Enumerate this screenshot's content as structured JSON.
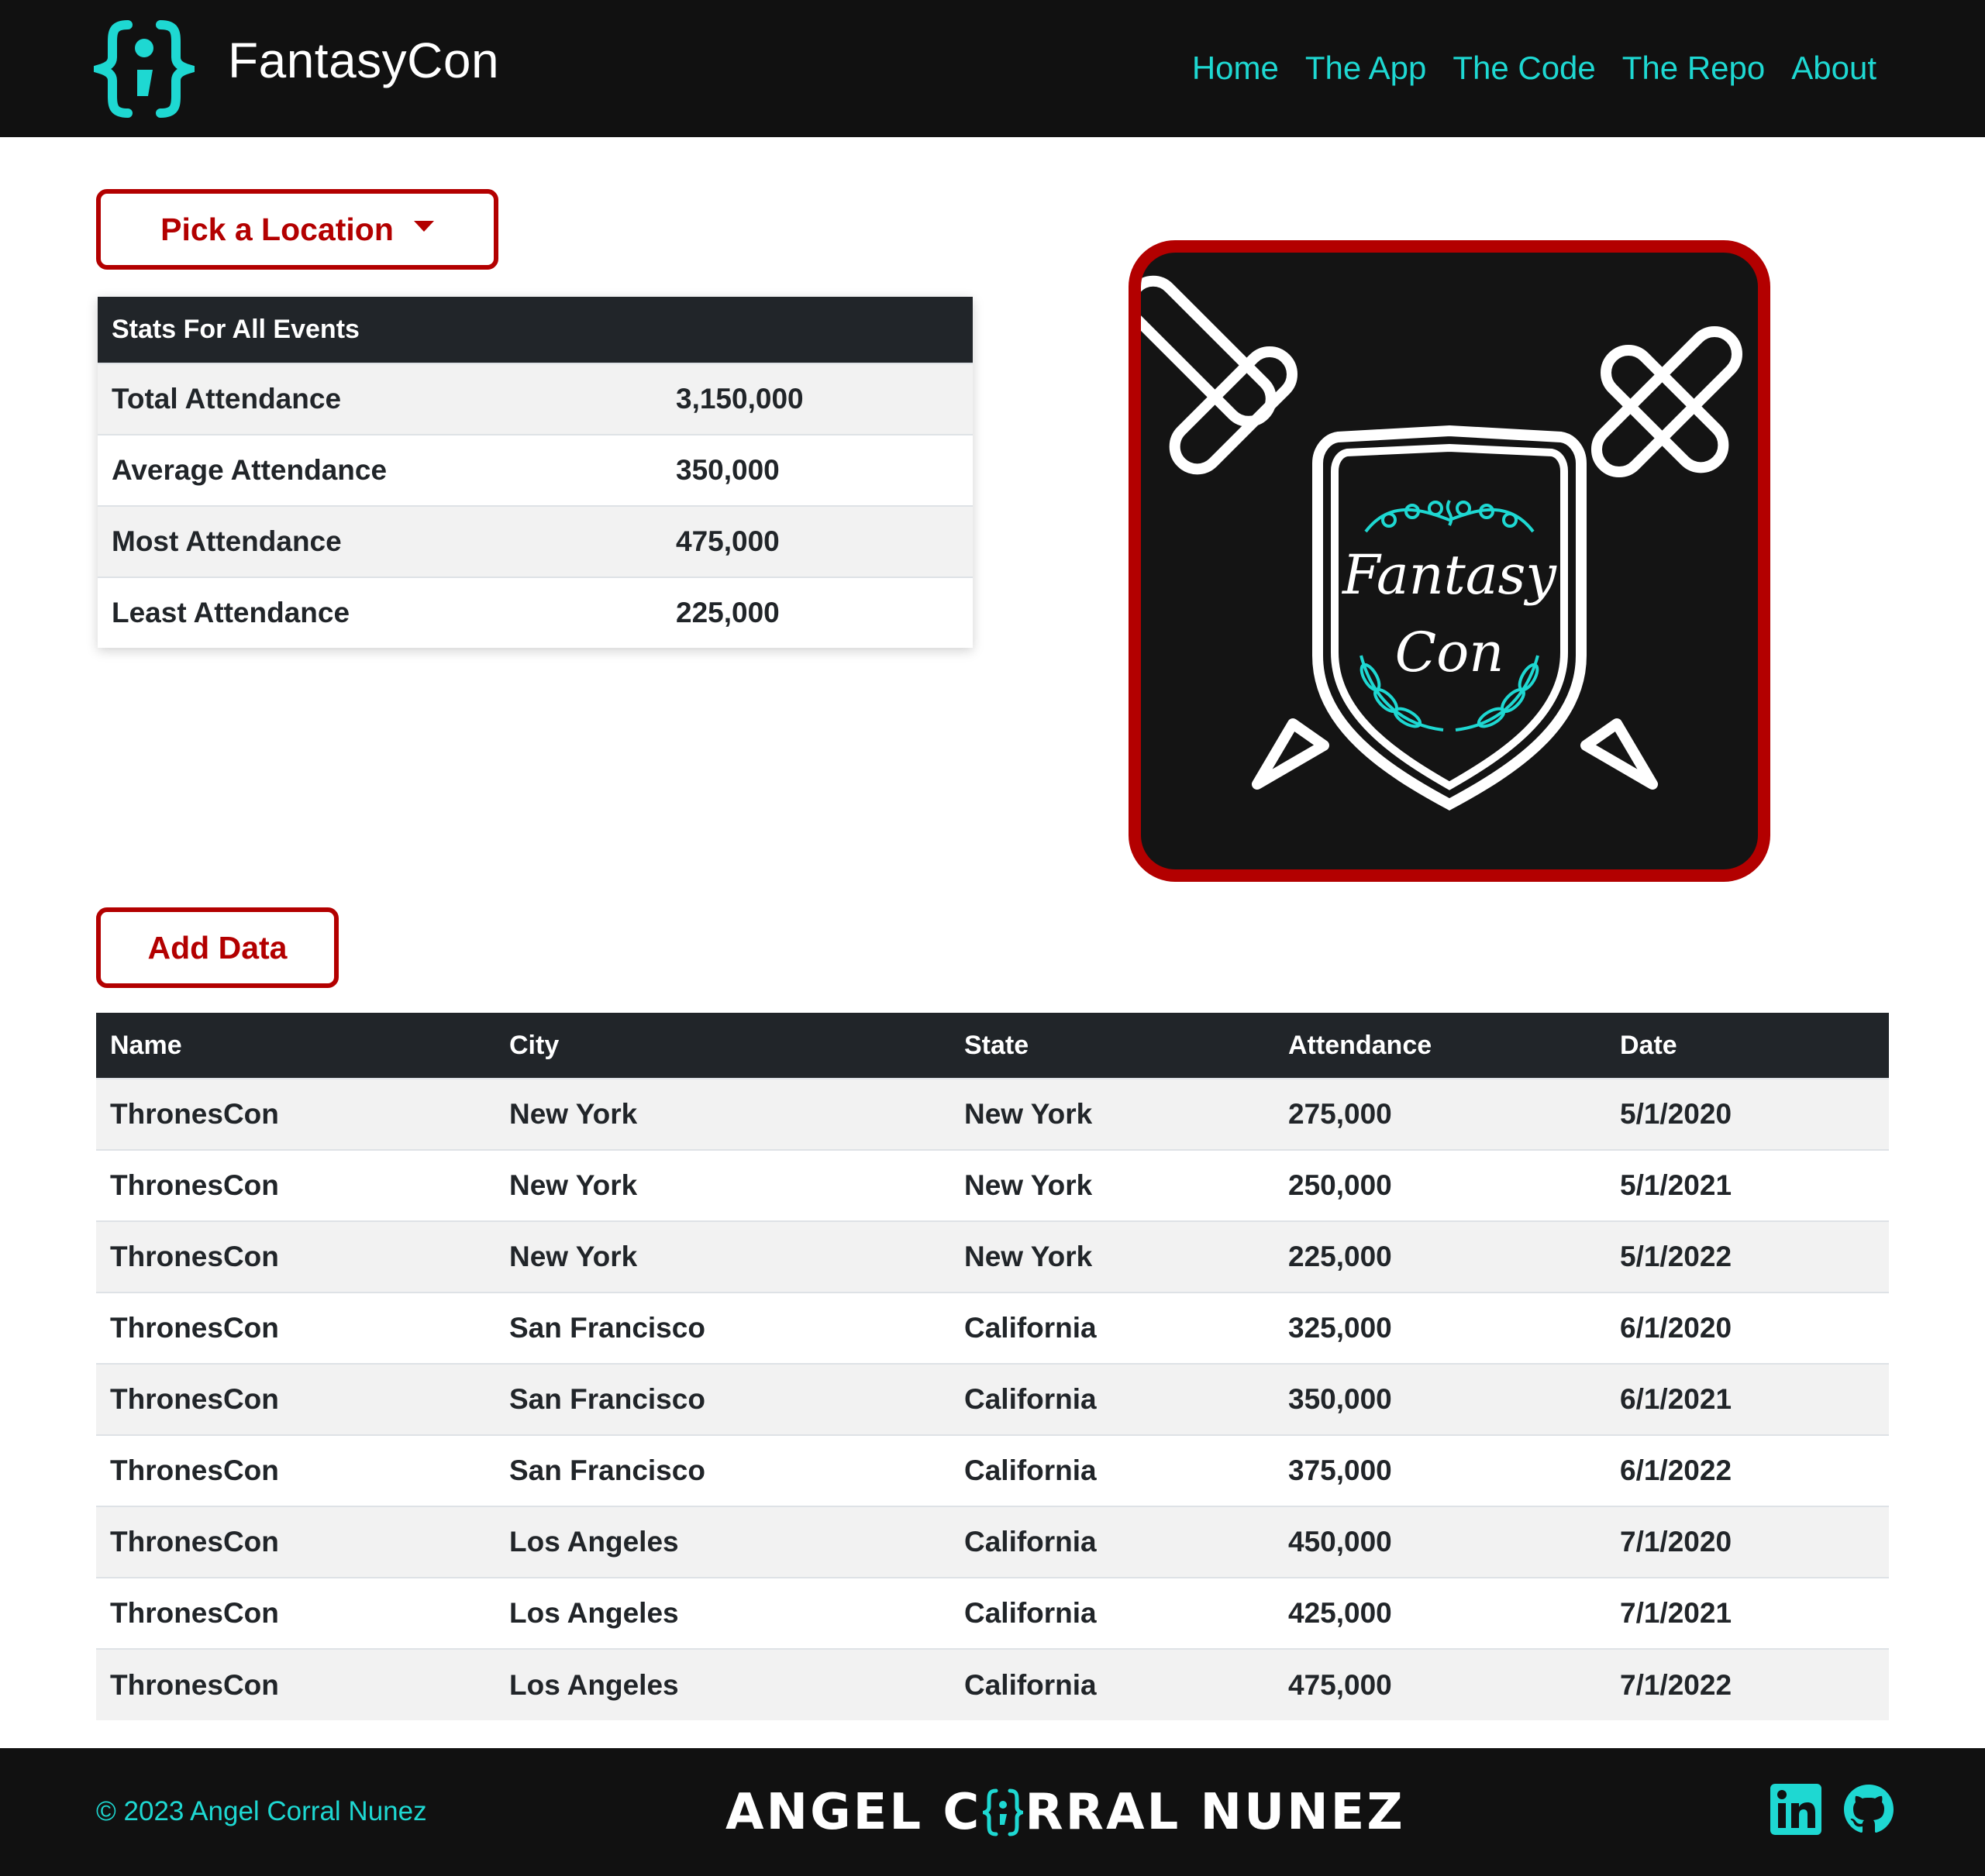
{
  "navbar": {
    "brand": "FantasyCon",
    "links": [
      "Home",
      "The App",
      "The Code",
      "The Repo",
      "About"
    ]
  },
  "controls": {
    "pick_location_label": "Pick a Location",
    "add_data_label": "Add Data"
  },
  "stats": {
    "title": "Stats For All Events",
    "rows": [
      {
        "label": "Total Attendance",
        "value": "3,150,000"
      },
      {
        "label": "Average Attendance",
        "value": "350,000"
      },
      {
        "label": "Most Attendance",
        "value": "475,000"
      },
      {
        "label": "Least Attendance",
        "value": "225,000"
      }
    ]
  },
  "emblem": {
    "line1": "Fantasy",
    "line2": "Con",
    "colors": {
      "border": "#b30000",
      "background": "#141414",
      "accent": "#1ed8d2"
    }
  },
  "events": {
    "headers": [
      "Name",
      "City",
      "State",
      "Attendance",
      "Date"
    ],
    "rows": [
      [
        "ThronesCon",
        "New York",
        "New York",
        "275,000",
        "5/1/2020"
      ],
      [
        "ThronesCon",
        "New York",
        "New York",
        "250,000",
        "5/1/2021"
      ],
      [
        "ThronesCon",
        "New York",
        "New York",
        "225,000",
        "5/1/2022"
      ],
      [
        "ThronesCon",
        "San Francisco",
        "California",
        "325,000",
        "6/1/2020"
      ],
      [
        "ThronesCon",
        "San Francisco",
        "California",
        "350,000",
        "6/1/2021"
      ],
      [
        "ThronesCon",
        "San Francisco",
        "California",
        "375,000",
        "6/1/2022"
      ],
      [
        "ThronesCon",
        "Los Angeles",
        "California",
        "450,000",
        "7/1/2020"
      ],
      [
        "ThronesCon",
        "Los Angeles",
        "California",
        "425,000",
        "7/1/2021"
      ],
      [
        "ThronesCon",
        "Los Angeles",
        "California",
        "475,000",
        "7/1/2022"
      ]
    ]
  },
  "footer": {
    "copyright": "© 2023 Angel Corral Nunez",
    "brand_left": "ANGEL C",
    "brand_right": "RRAL NUNEZ",
    "icons": [
      "linkedin-icon",
      "github-icon"
    ]
  },
  "theme": {
    "accent": "#1ed8d2",
    "brand_red": "#b30000",
    "dark": "#111111",
    "table_head": "#212529"
  }
}
